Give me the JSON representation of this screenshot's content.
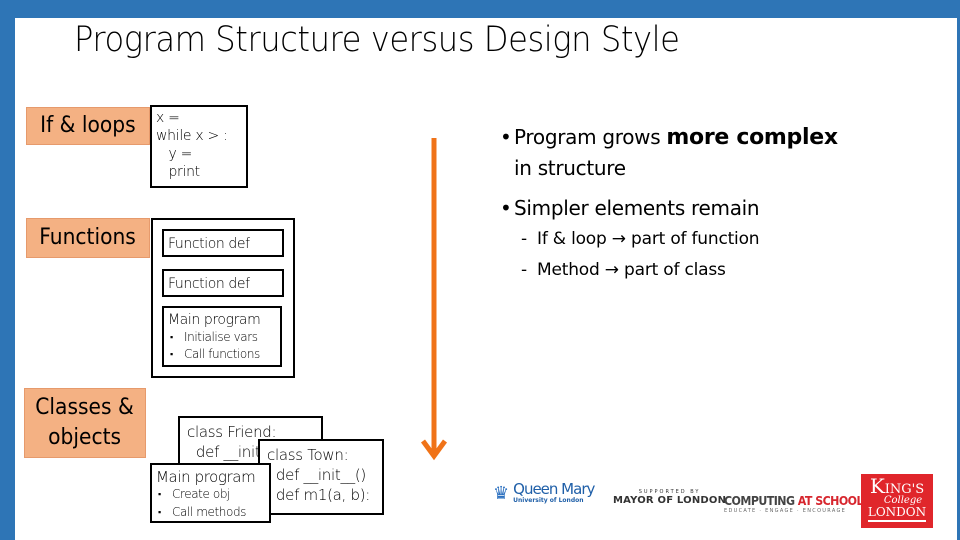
{
  "slide": {
    "title": "Program Structure versus Design Style"
  },
  "colors": {
    "frame": "#2e75b6",
    "label_fill": "#f4b183",
    "arrow": "#f07318",
    "kcl_red": "#e0262b"
  },
  "levels": {
    "if_loops": {
      "label": "If & loops",
      "code": "x =\nwhile x > :\n   y =\n   print"
    },
    "functions": {
      "label": "Functions",
      "function_def_1": "Function def",
      "function_def_2": "Function def",
      "main_program": {
        "title": "Main program",
        "bullets": [
          "Initialise vars",
          "Call functions"
        ]
      }
    },
    "classes": {
      "label_line1": "Classes &",
      "label_line2": "objects",
      "friend_class": "class Friend:\n  def __init__()\n  def m1(a):",
      "town_class": "class Town:\n  def __init__()\n  def m1(a, b):",
      "main_program": {
        "title": "Main program",
        "bullets": [
          "Create obj",
          "Call methods"
        ]
      }
    }
  },
  "bullets": {
    "b1_prefix": "Program grows ",
    "b1_bold": "more complex",
    "b1_line2": "in structure",
    "b2": "Simpler elements remain",
    "sub": [
      {
        "left": "If & loop ",
        "arrow": "→",
        "right": " part of function"
      },
      {
        "left": "Method ",
        "arrow": "→",
        "right": " part of class"
      }
    ]
  },
  "logos": {
    "queen_mary": {
      "name": "Queen Mary",
      "sub": "University of London"
    },
    "mayor": {
      "supported": "SUPPORTED BY",
      "name": "MAYOR OF LONDON"
    },
    "cas": {
      "part1": "COMPUTING ",
      "part2": "AT SCHOOL",
      "tagline": "EDUCATE · ENGAGE · ENCOURAGE"
    },
    "kcl": {
      "k": "K",
      "ings": "ING'S",
      "college": "College",
      "london": "LONDON"
    }
  }
}
